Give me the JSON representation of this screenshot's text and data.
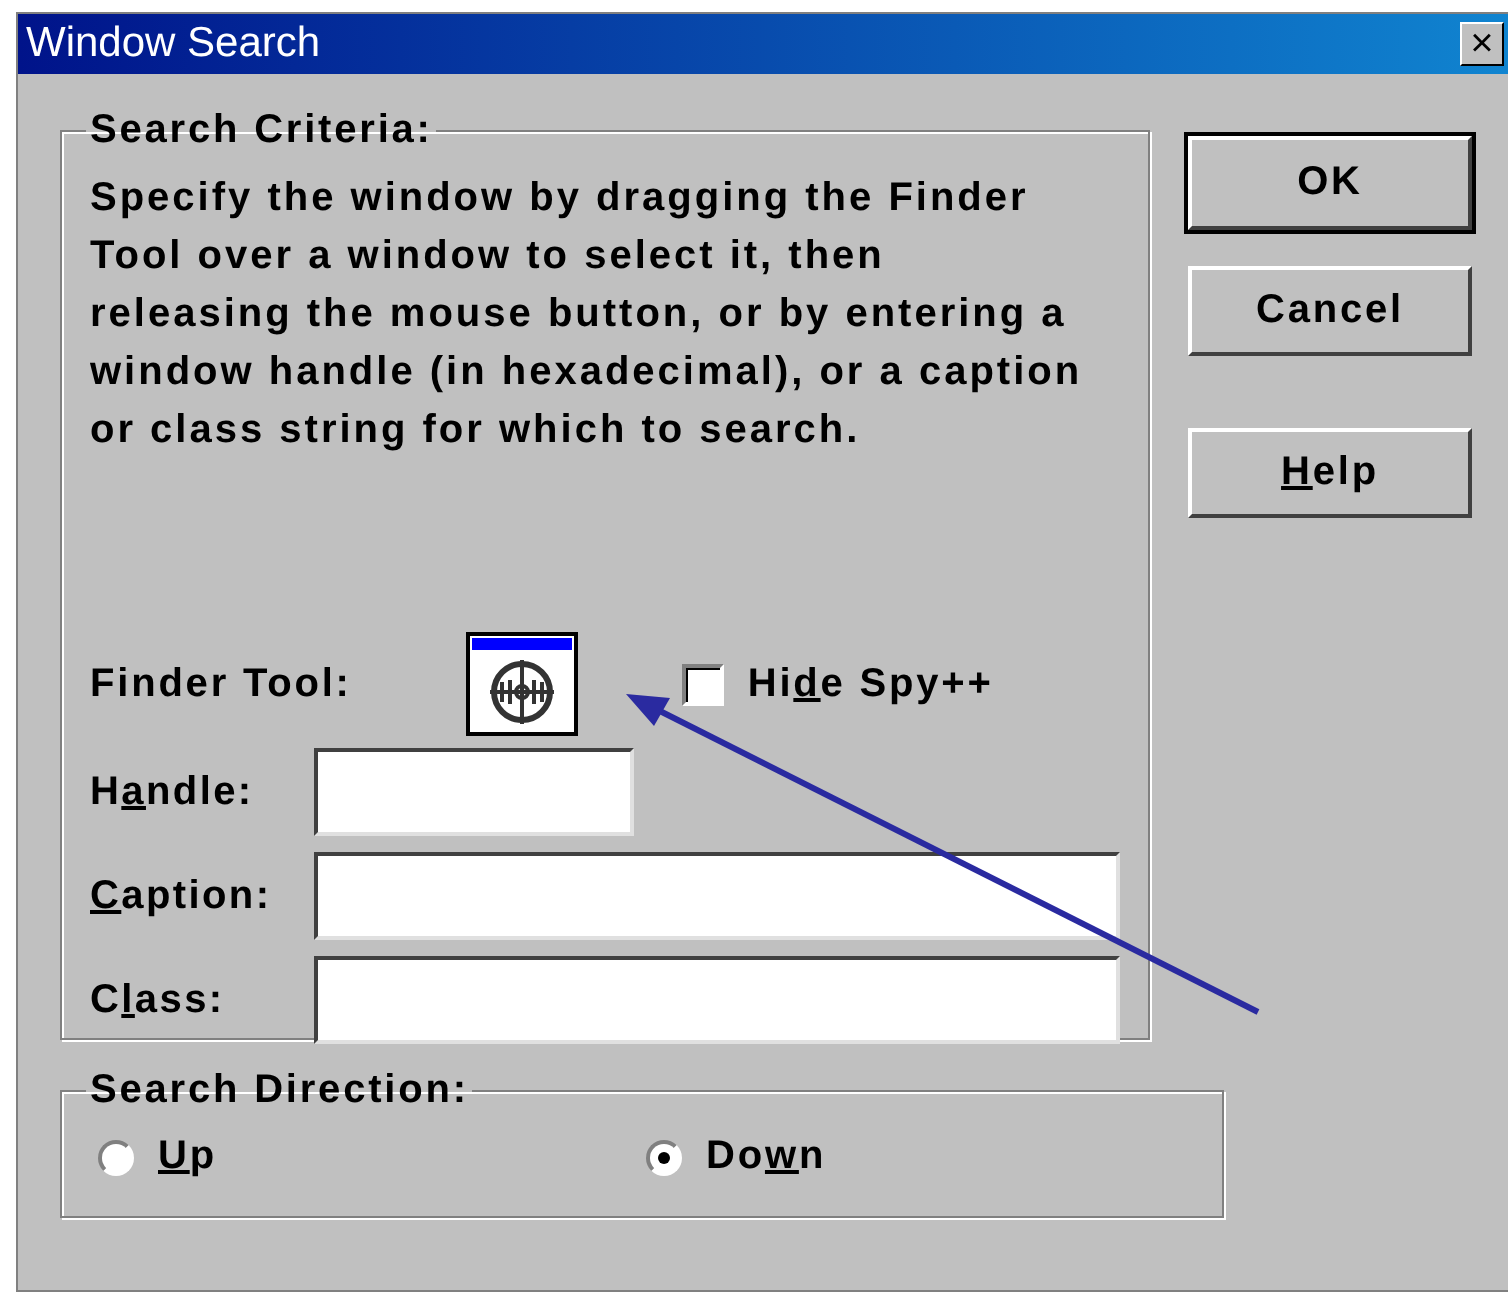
{
  "window": {
    "title": "Window Search",
    "close": "×"
  },
  "criteria": {
    "title": "Search Criteria:",
    "description": "Specify the window by dragging the Finder Tool over a window to select it, then releasing the mouse button, or by entering a window handle (in hexadecimal), or a caption or class string for which to search.",
    "finder_label": "Finder Tool:",
    "hide_spy": {
      "label": {
        "pre": "Hi",
        "key": "d",
        "post": "e Spy++"
      },
      "checked": false
    },
    "fields": [
      {
        "label": {
          "pre": "H",
          "key": "a",
          "post": "ndle:"
        },
        "kind": "short"
      },
      {
        "label": {
          "key": "C",
          "post": "aption:"
        },
        "kind": "long"
      },
      {
        "label": {
          "pre": "C",
          "key": "l",
          "post": "ass:"
        },
        "kind": "long"
      }
    ]
  },
  "direction": {
    "title": "Search Direction:",
    "options": [
      {
        "label": {
          "key": "U",
          "post": "p"
        },
        "selected": false
      },
      {
        "label": {
          "pre": "Do",
          "key": "w",
          "post": "n"
        },
        "selected": true
      }
    ]
  },
  "buttons": [
    {
      "label": {
        "pre": "OK"
      },
      "default": true
    },
    {
      "label": {
        "pre": "Cancel"
      },
      "default": false
    },
    {
      "label": {
        "key": "H",
        "post": "elp"
      },
      "default": false
    }
  ]
}
